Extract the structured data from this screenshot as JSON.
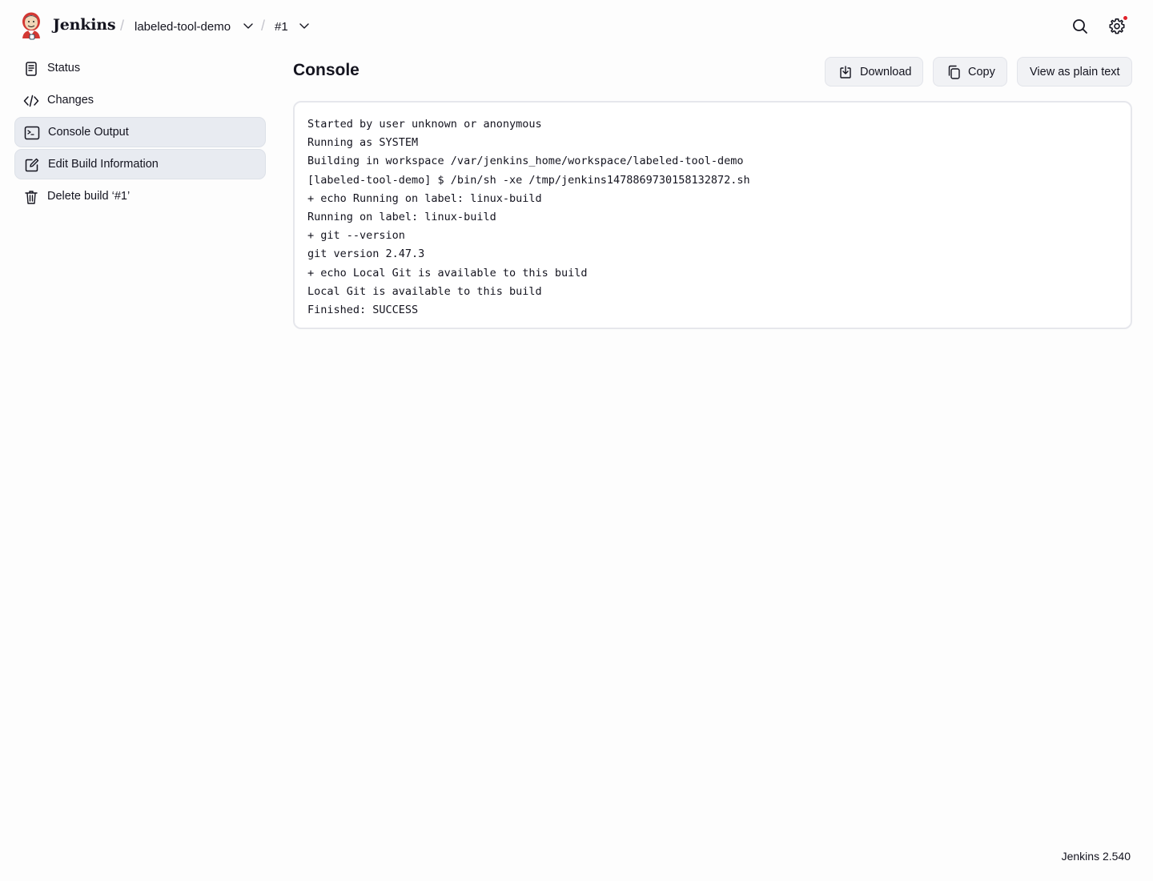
{
  "header": {
    "brand": "Jenkins",
    "breadcrumbs": [
      {
        "label": "labeled-tool-demo"
      },
      {
        "label": "#1"
      }
    ],
    "separator": "/"
  },
  "sidebar": {
    "items": [
      {
        "label": "Status",
        "icon": "document-icon"
      },
      {
        "label": "Changes",
        "icon": "code-icon"
      },
      {
        "label": "Console Output",
        "icon": "terminal-icon"
      },
      {
        "label": "Edit Build Information",
        "icon": "edit-icon"
      },
      {
        "label": "Delete build ‘#1’",
        "icon": "trash-icon"
      }
    ]
  },
  "main": {
    "title": "Console",
    "buttons": {
      "download": "Download",
      "copy": "Copy",
      "plain_text": "View as plain text"
    },
    "console_lines": [
      "Started by user unknown or anonymous",
      "Running as SYSTEM",
      "Building in workspace /var/jenkins_home/workspace/labeled-tool-demo",
      "[labeled-tool-demo] $ /bin/sh -xe /tmp/jenkins1478869730158132872.sh",
      "+ echo Running on label: linux-build",
      "Running on label: linux-build",
      "+ git --version",
      "git version 2.47.3",
      "+ echo Local Git is available to this build",
      "Local Git is available to this build",
      "Finished: SUCCESS"
    ]
  },
  "footer": {
    "version": "Jenkins 2.540"
  },
  "colors": {
    "notification": "#e0222a",
    "active_item_bg": "#e8ebf1",
    "button_bg": "#f1f2f5"
  }
}
